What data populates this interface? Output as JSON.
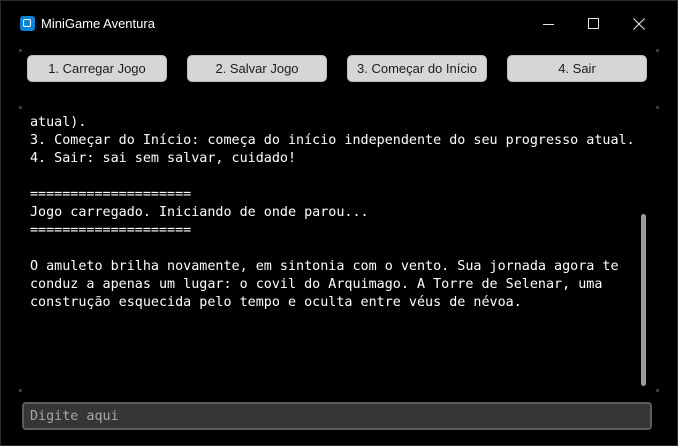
{
  "window": {
    "title": "MiniGame Aventura",
    "icon": "app-window-icon",
    "controls": {
      "minimize_icon": "minimize-icon",
      "maximize_icon": "maximize-icon",
      "close_icon": "close-icon"
    }
  },
  "toolbar": {
    "buttons": [
      {
        "label": "1. Carregar Jogo"
      },
      {
        "label": "2. Salvar Jogo"
      },
      {
        "label": "3. Começar do Início"
      },
      {
        "label": "4. Sair"
      }
    ]
  },
  "log": {
    "lines": [
      "atual).",
      "3. Começar do Início: começa do início independente do seu progresso atual.",
      "4. Sair: sai sem salvar, cuidado!",
      "",
      "====================",
      "Jogo carregado. Iniciando de onde parou...",
      "====================",
      "",
      "O amuleto brilha novamente, em sintonia com o vento. Sua jornada agora te",
      "conduz a apenas um lugar: o covil do Arquimago. A Torre de Selenar, uma",
      "construção esquecida pelo tempo e oculta entre véus de névoa."
    ]
  },
  "input": {
    "placeholder": "Digite aqui",
    "value": ""
  },
  "colors": {
    "background": "#000000",
    "text": "#ffffff",
    "button_bg": "#d6d6d6",
    "input_bg": "#363636",
    "scrollbar_thumb": "#9a9a9a",
    "icon_accent": "#0a84d8"
  }
}
